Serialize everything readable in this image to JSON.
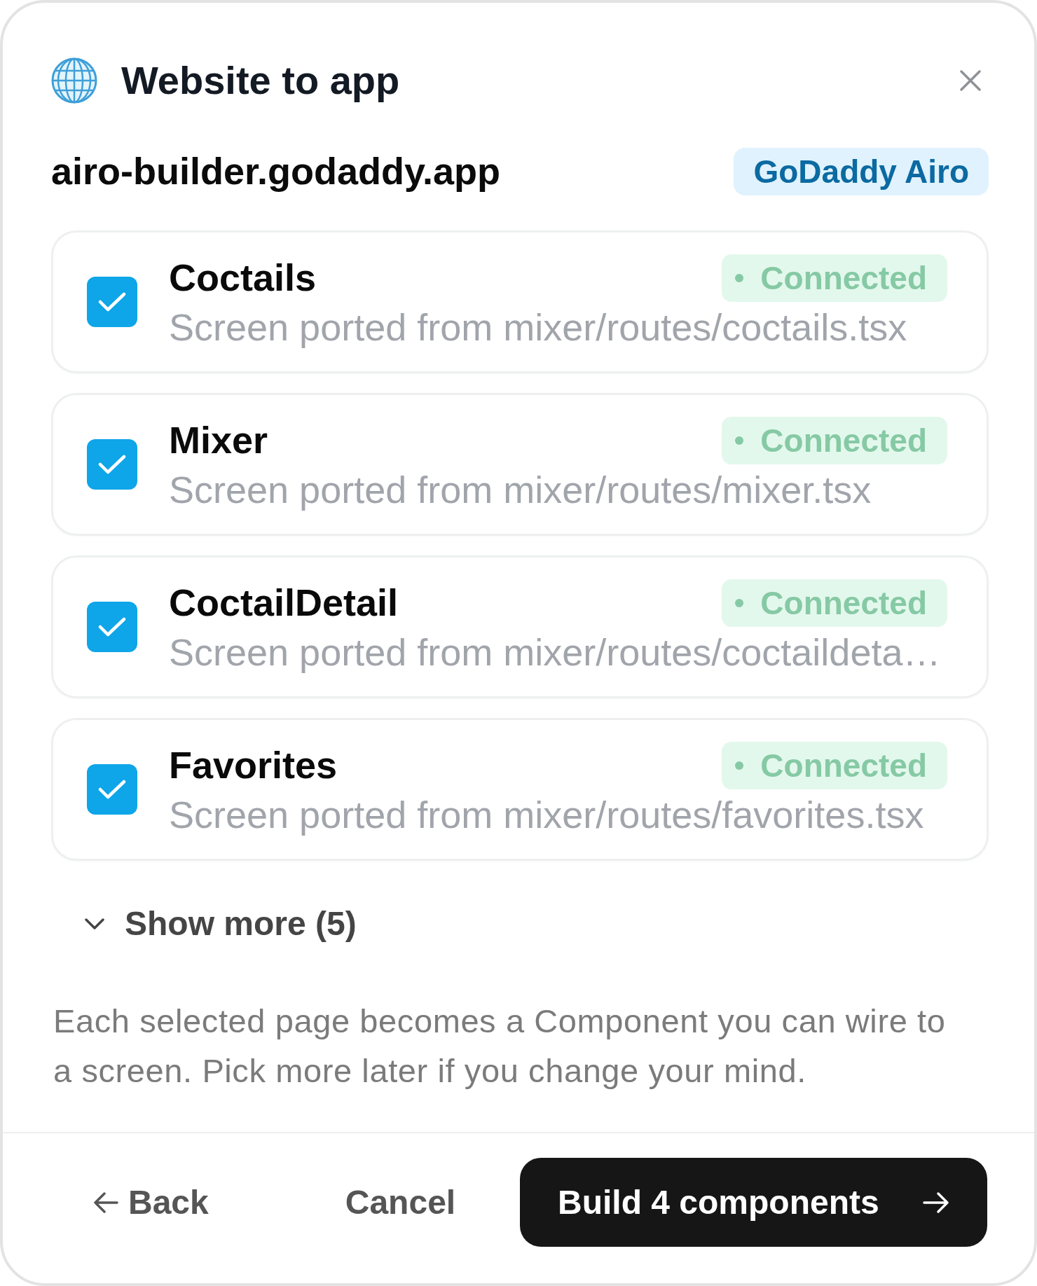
{
  "dialog": {
    "title": "Website to app"
  },
  "site": {
    "domain": "airo-builder.godaddy.app",
    "platform": "GoDaddy Airo"
  },
  "pages": [
    {
      "name": "Coctails",
      "description": "Screen ported from mixer/routes/coctails.tsx",
      "checked": true,
      "status": "Connected"
    },
    {
      "name": "Mixer",
      "description": "Screen ported from mixer/routes/mixer.tsx",
      "checked": true,
      "status": "Connected"
    },
    {
      "name": "CoctailDetail",
      "description": "Screen ported from mixer/routes/coctaildeta…",
      "checked": true,
      "status": "Connected"
    },
    {
      "name": "Favorites",
      "description": "Screen ported from mixer/routes/favorites.tsx",
      "checked": true,
      "status": "Connected"
    }
  ],
  "show_more": {
    "label": "Show more (5)",
    "expanded": false
  },
  "note": "Each selected page becomes a Component you can wire to a screen. Pick more later if you change your mind.",
  "footer": {
    "back": "Back",
    "cancel": "Cancel",
    "submit": "Build 4 components"
  }
}
